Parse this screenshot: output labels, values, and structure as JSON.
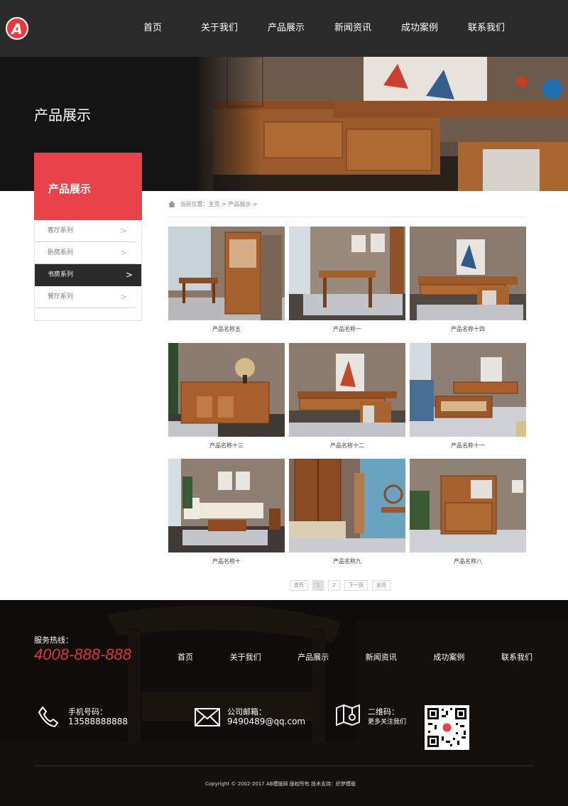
{
  "header": {
    "logo_letter": "A",
    "nav": [
      "首页",
      "关于我们",
      "产品展示",
      "新闻资讯",
      "成功案例",
      "联系我们"
    ]
  },
  "banner": {
    "title": "产品展示"
  },
  "sidebar": {
    "title": "产品展示",
    "items": [
      {
        "label": "客厅系列",
        "active": false
      },
      {
        "label": "卧房系列",
        "active": false
      },
      {
        "label": "书房系列",
        "active": true
      },
      {
        "label": "餐厅系列",
        "active": false
      }
    ],
    "arrow": ">"
  },
  "breadcrumb": {
    "text": "当前位置：主页 > 产品展示 >"
  },
  "products": [
    {
      "name": "产品名称五"
    },
    {
      "name": "产品名称一"
    },
    {
      "name": "产品名称十四"
    },
    {
      "name": "产品名称十三"
    },
    {
      "name": "产品名称十二"
    },
    {
      "name": "产品名称十一"
    },
    {
      "name": "产品名称十"
    },
    {
      "name": "产品名称九"
    },
    {
      "name": "产品名称八"
    }
  ],
  "pagination": {
    "first": "首页",
    "pages": [
      "1",
      "2"
    ],
    "current": "1",
    "next": "下一页",
    "last": "末页"
  },
  "footer": {
    "hotline_label": "服务热线：",
    "hotline": "4008-888-888",
    "nav": [
      "首页",
      "关于我们",
      "产品展示",
      "新闻资讯",
      "成功案例",
      "联系我们"
    ],
    "phone_label": "手机号码：",
    "phone": "13588888888",
    "email_label": "公司邮箱：",
    "email": "9490489@qq.com",
    "qr_label": "二维码：",
    "qr_sub": "更多关注我们",
    "copyright": "Copyright © 2002-2017 AB模版网 版权所有 技术支持：织梦模版"
  },
  "colors": {
    "accent": "#e9424b",
    "header_bg": "#2b2b2b",
    "hotline": "#e2353b"
  }
}
